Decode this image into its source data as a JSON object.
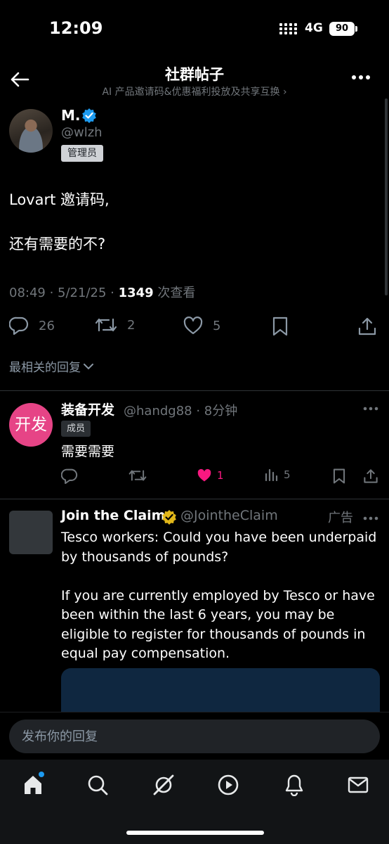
{
  "status_bar": {
    "time": "12:09",
    "network": "4G",
    "battery": "90"
  },
  "header": {
    "title": "社群帖子",
    "subtitle": "AI 产品邀请码&优惠福利投放及共享互换 ›",
    "back_icon": "arrow-left-icon",
    "more_icon": "more-horizontal-icon"
  },
  "post": {
    "author": "M.",
    "handle": "@wlzh",
    "role_badge": "管理员",
    "line1": "Lovart 邀请码,",
    "line2": "还有需要的不?",
    "time": "08:49 · 5/21/25 · ",
    "views_count": "1349",
    "views_label": " 次查看",
    "replies": "26",
    "reposts": "2",
    "likes": "5"
  },
  "sort_label": "最相关的回复",
  "reply": {
    "avatar_text": "开发",
    "name": "装备开发",
    "handle_time": "@handg88 · 8分钟",
    "role_badge": "成员",
    "text": "需要需要",
    "likes": "1",
    "views": "5"
  },
  "ad": {
    "name": "Join the Claim",
    "handle": "@JointheClaim",
    "label": "广告",
    "p1": "Tesco workers: Could you have been underpaid by thousands of pounds?",
    "p2": "If you are currently employed by Tesco or have been within the last 6 years, you may be eligible to register for thousands of pounds in equal pay compensation."
  },
  "reply_input": {
    "placeholder": "发布你的回复"
  },
  "tabs": [
    "home-icon",
    "search-icon",
    "grok-icon",
    "play-icon",
    "bell-icon",
    "mail-icon"
  ],
  "colors": {
    "accent": "#1d9bf0",
    "like": "#f91880",
    "verified_gold": "#e2b719",
    "badge_pink": "#e64486"
  }
}
